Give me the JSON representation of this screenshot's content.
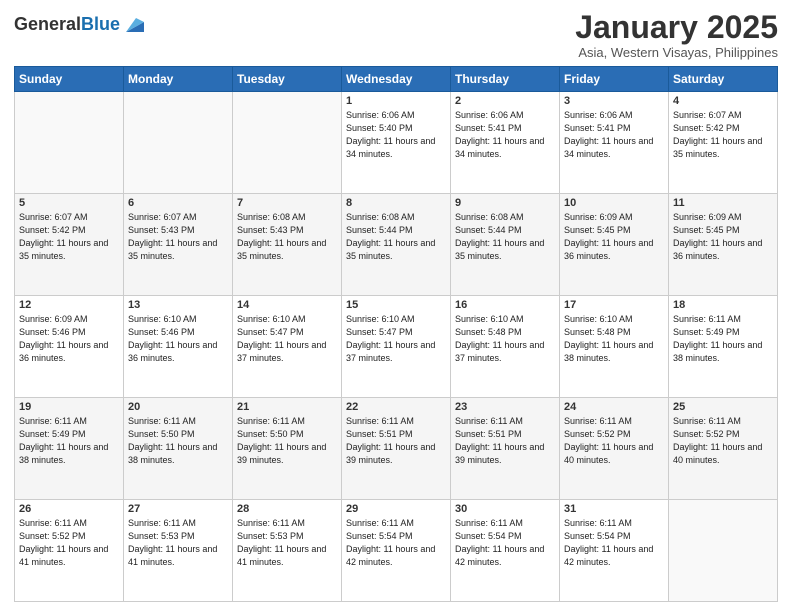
{
  "header": {
    "logo_general": "General",
    "logo_blue": "Blue",
    "month": "January 2025",
    "location": "Asia, Western Visayas, Philippines"
  },
  "weekdays": [
    "Sunday",
    "Monday",
    "Tuesday",
    "Wednesday",
    "Thursday",
    "Friday",
    "Saturday"
  ],
  "weeks": [
    [
      {
        "day": "",
        "sunrise": "",
        "sunset": "",
        "daylight": ""
      },
      {
        "day": "",
        "sunrise": "",
        "sunset": "",
        "daylight": ""
      },
      {
        "day": "",
        "sunrise": "",
        "sunset": "",
        "daylight": ""
      },
      {
        "day": "1",
        "sunrise": "Sunrise: 6:06 AM",
        "sunset": "Sunset: 5:40 PM",
        "daylight": "Daylight: 11 hours and 34 minutes."
      },
      {
        "day": "2",
        "sunrise": "Sunrise: 6:06 AM",
        "sunset": "Sunset: 5:41 PM",
        "daylight": "Daylight: 11 hours and 34 minutes."
      },
      {
        "day": "3",
        "sunrise": "Sunrise: 6:06 AM",
        "sunset": "Sunset: 5:41 PM",
        "daylight": "Daylight: 11 hours and 34 minutes."
      },
      {
        "day": "4",
        "sunrise": "Sunrise: 6:07 AM",
        "sunset": "Sunset: 5:42 PM",
        "daylight": "Daylight: 11 hours and 35 minutes."
      }
    ],
    [
      {
        "day": "5",
        "sunrise": "Sunrise: 6:07 AM",
        "sunset": "Sunset: 5:42 PM",
        "daylight": "Daylight: 11 hours and 35 minutes."
      },
      {
        "day": "6",
        "sunrise": "Sunrise: 6:07 AM",
        "sunset": "Sunset: 5:43 PM",
        "daylight": "Daylight: 11 hours and 35 minutes."
      },
      {
        "day": "7",
        "sunrise": "Sunrise: 6:08 AM",
        "sunset": "Sunset: 5:43 PM",
        "daylight": "Daylight: 11 hours and 35 minutes."
      },
      {
        "day": "8",
        "sunrise": "Sunrise: 6:08 AM",
        "sunset": "Sunset: 5:44 PM",
        "daylight": "Daylight: 11 hours and 35 minutes."
      },
      {
        "day": "9",
        "sunrise": "Sunrise: 6:08 AM",
        "sunset": "Sunset: 5:44 PM",
        "daylight": "Daylight: 11 hours and 35 minutes."
      },
      {
        "day": "10",
        "sunrise": "Sunrise: 6:09 AM",
        "sunset": "Sunset: 5:45 PM",
        "daylight": "Daylight: 11 hours and 36 minutes."
      },
      {
        "day": "11",
        "sunrise": "Sunrise: 6:09 AM",
        "sunset": "Sunset: 5:45 PM",
        "daylight": "Daylight: 11 hours and 36 minutes."
      }
    ],
    [
      {
        "day": "12",
        "sunrise": "Sunrise: 6:09 AM",
        "sunset": "Sunset: 5:46 PM",
        "daylight": "Daylight: 11 hours and 36 minutes."
      },
      {
        "day": "13",
        "sunrise": "Sunrise: 6:10 AM",
        "sunset": "Sunset: 5:46 PM",
        "daylight": "Daylight: 11 hours and 36 minutes."
      },
      {
        "day": "14",
        "sunrise": "Sunrise: 6:10 AM",
        "sunset": "Sunset: 5:47 PM",
        "daylight": "Daylight: 11 hours and 37 minutes."
      },
      {
        "day": "15",
        "sunrise": "Sunrise: 6:10 AM",
        "sunset": "Sunset: 5:47 PM",
        "daylight": "Daylight: 11 hours and 37 minutes."
      },
      {
        "day": "16",
        "sunrise": "Sunrise: 6:10 AM",
        "sunset": "Sunset: 5:48 PM",
        "daylight": "Daylight: 11 hours and 37 minutes."
      },
      {
        "day": "17",
        "sunrise": "Sunrise: 6:10 AM",
        "sunset": "Sunset: 5:48 PM",
        "daylight": "Daylight: 11 hours and 38 minutes."
      },
      {
        "day": "18",
        "sunrise": "Sunrise: 6:11 AM",
        "sunset": "Sunset: 5:49 PM",
        "daylight": "Daylight: 11 hours and 38 minutes."
      }
    ],
    [
      {
        "day": "19",
        "sunrise": "Sunrise: 6:11 AM",
        "sunset": "Sunset: 5:49 PM",
        "daylight": "Daylight: 11 hours and 38 minutes."
      },
      {
        "day": "20",
        "sunrise": "Sunrise: 6:11 AM",
        "sunset": "Sunset: 5:50 PM",
        "daylight": "Daylight: 11 hours and 38 minutes."
      },
      {
        "day": "21",
        "sunrise": "Sunrise: 6:11 AM",
        "sunset": "Sunset: 5:50 PM",
        "daylight": "Daylight: 11 hours and 39 minutes."
      },
      {
        "day": "22",
        "sunrise": "Sunrise: 6:11 AM",
        "sunset": "Sunset: 5:51 PM",
        "daylight": "Daylight: 11 hours and 39 minutes."
      },
      {
        "day": "23",
        "sunrise": "Sunrise: 6:11 AM",
        "sunset": "Sunset: 5:51 PM",
        "daylight": "Daylight: 11 hours and 39 minutes."
      },
      {
        "day": "24",
        "sunrise": "Sunrise: 6:11 AM",
        "sunset": "Sunset: 5:52 PM",
        "daylight": "Daylight: 11 hours and 40 minutes."
      },
      {
        "day": "25",
        "sunrise": "Sunrise: 6:11 AM",
        "sunset": "Sunset: 5:52 PM",
        "daylight": "Daylight: 11 hours and 40 minutes."
      }
    ],
    [
      {
        "day": "26",
        "sunrise": "Sunrise: 6:11 AM",
        "sunset": "Sunset: 5:52 PM",
        "daylight": "Daylight: 11 hours and 41 minutes."
      },
      {
        "day": "27",
        "sunrise": "Sunrise: 6:11 AM",
        "sunset": "Sunset: 5:53 PM",
        "daylight": "Daylight: 11 hours and 41 minutes."
      },
      {
        "day": "28",
        "sunrise": "Sunrise: 6:11 AM",
        "sunset": "Sunset: 5:53 PM",
        "daylight": "Daylight: 11 hours and 41 minutes."
      },
      {
        "day": "29",
        "sunrise": "Sunrise: 6:11 AM",
        "sunset": "Sunset: 5:54 PM",
        "daylight": "Daylight: 11 hours and 42 minutes."
      },
      {
        "day": "30",
        "sunrise": "Sunrise: 6:11 AM",
        "sunset": "Sunset: 5:54 PM",
        "daylight": "Daylight: 11 hours and 42 minutes."
      },
      {
        "day": "31",
        "sunrise": "Sunrise: 6:11 AM",
        "sunset": "Sunset: 5:54 PM",
        "daylight": "Daylight: 11 hours and 42 minutes."
      },
      {
        "day": "",
        "sunrise": "",
        "sunset": "",
        "daylight": ""
      }
    ]
  ]
}
